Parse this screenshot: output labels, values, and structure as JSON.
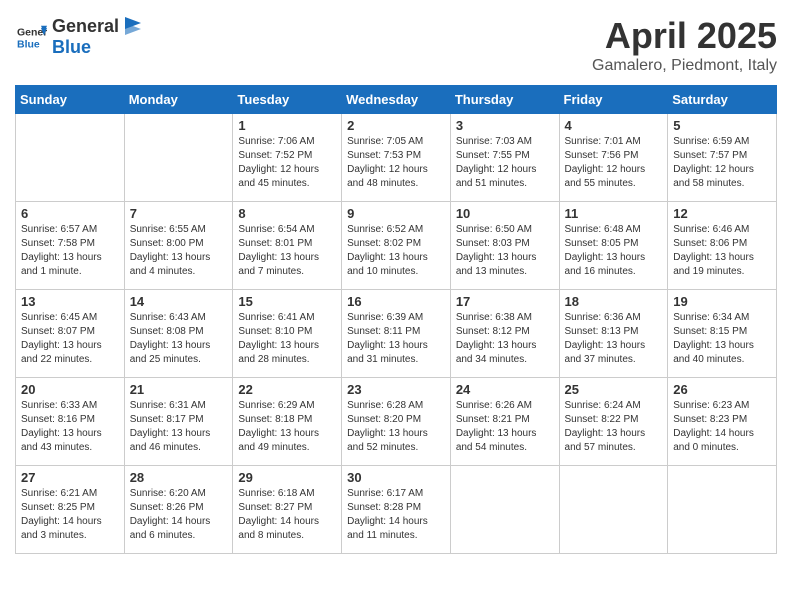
{
  "header": {
    "logo_general": "General",
    "logo_blue": "Blue",
    "title": "April 2025",
    "subtitle": "Gamalero, Piedmont, Italy"
  },
  "weekdays": [
    "Sunday",
    "Monday",
    "Tuesday",
    "Wednesday",
    "Thursday",
    "Friday",
    "Saturday"
  ],
  "weeks": [
    [
      {
        "day": "",
        "info": ""
      },
      {
        "day": "",
        "info": ""
      },
      {
        "day": "1",
        "info": "Sunrise: 7:06 AM\nSunset: 7:52 PM\nDaylight: 12 hours and 45 minutes."
      },
      {
        "day": "2",
        "info": "Sunrise: 7:05 AM\nSunset: 7:53 PM\nDaylight: 12 hours and 48 minutes."
      },
      {
        "day": "3",
        "info": "Sunrise: 7:03 AM\nSunset: 7:55 PM\nDaylight: 12 hours and 51 minutes."
      },
      {
        "day": "4",
        "info": "Sunrise: 7:01 AM\nSunset: 7:56 PM\nDaylight: 12 hours and 55 minutes."
      },
      {
        "day": "5",
        "info": "Sunrise: 6:59 AM\nSunset: 7:57 PM\nDaylight: 12 hours and 58 minutes."
      }
    ],
    [
      {
        "day": "6",
        "info": "Sunrise: 6:57 AM\nSunset: 7:58 PM\nDaylight: 13 hours and 1 minute."
      },
      {
        "day": "7",
        "info": "Sunrise: 6:55 AM\nSunset: 8:00 PM\nDaylight: 13 hours and 4 minutes."
      },
      {
        "day": "8",
        "info": "Sunrise: 6:54 AM\nSunset: 8:01 PM\nDaylight: 13 hours and 7 minutes."
      },
      {
        "day": "9",
        "info": "Sunrise: 6:52 AM\nSunset: 8:02 PM\nDaylight: 13 hours and 10 minutes."
      },
      {
        "day": "10",
        "info": "Sunrise: 6:50 AM\nSunset: 8:03 PM\nDaylight: 13 hours and 13 minutes."
      },
      {
        "day": "11",
        "info": "Sunrise: 6:48 AM\nSunset: 8:05 PM\nDaylight: 13 hours and 16 minutes."
      },
      {
        "day": "12",
        "info": "Sunrise: 6:46 AM\nSunset: 8:06 PM\nDaylight: 13 hours and 19 minutes."
      }
    ],
    [
      {
        "day": "13",
        "info": "Sunrise: 6:45 AM\nSunset: 8:07 PM\nDaylight: 13 hours and 22 minutes."
      },
      {
        "day": "14",
        "info": "Sunrise: 6:43 AM\nSunset: 8:08 PM\nDaylight: 13 hours and 25 minutes."
      },
      {
        "day": "15",
        "info": "Sunrise: 6:41 AM\nSunset: 8:10 PM\nDaylight: 13 hours and 28 minutes."
      },
      {
        "day": "16",
        "info": "Sunrise: 6:39 AM\nSunset: 8:11 PM\nDaylight: 13 hours and 31 minutes."
      },
      {
        "day": "17",
        "info": "Sunrise: 6:38 AM\nSunset: 8:12 PM\nDaylight: 13 hours and 34 minutes."
      },
      {
        "day": "18",
        "info": "Sunrise: 6:36 AM\nSunset: 8:13 PM\nDaylight: 13 hours and 37 minutes."
      },
      {
        "day": "19",
        "info": "Sunrise: 6:34 AM\nSunset: 8:15 PM\nDaylight: 13 hours and 40 minutes."
      }
    ],
    [
      {
        "day": "20",
        "info": "Sunrise: 6:33 AM\nSunset: 8:16 PM\nDaylight: 13 hours and 43 minutes."
      },
      {
        "day": "21",
        "info": "Sunrise: 6:31 AM\nSunset: 8:17 PM\nDaylight: 13 hours and 46 minutes."
      },
      {
        "day": "22",
        "info": "Sunrise: 6:29 AM\nSunset: 8:18 PM\nDaylight: 13 hours and 49 minutes."
      },
      {
        "day": "23",
        "info": "Sunrise: 6:28 AM\nSunset: 8:20 PM\nDaylight: 13 hours and 52 minutes."
      },
      {
        "day": "24",
        "info": "Sunrise: 6:26 AM\nSunset: 8:21 PM\nDaylight: 13 hours and 54 minutes."
      },
      {
        "day": "25",
        "info": "Sunrise: 6:24 AM\nSunset: 8:22 PM\nDaylight: 13 hours and 57 minutes."
      },
      {
        "day": "26",
        "info": "Sunrise: 6:23 AM\nSunset: 8:23 PM\nDaylight: 14 hours and 0 minutes."
      }
    ],
    [
      {
        "day": "27",
        "info": "Sunrise: 6:21 AM\nSunset: 8:25 PM\nDaylight: 14 hours and 3 minutes."
      },
      {
        "day": "28",
        "info": "Sunrise: 6:20 AM\nSunset: 8:26 PM\nDaylight: 14 hours and 6 minutes."
      },
      {
        "day": "29",
        "info": "Sunrise: 6:18 AM\nSunset: 8:27 PM\nDaylight: 14 hours and 8 minutes."
      },
      {
        "day": "30",
        "info": "Sunrise: 6:17 AM\nSunset: 8:28 PM\nDaylight: 14 hours and 11 minutes."
      },
      {
        "day": "",
        "info": ""
      },
      {
        "day": "",
        "info": ""
      },
      {
        "day": "",
        "info": ""
      }
    ]
  ]
}
